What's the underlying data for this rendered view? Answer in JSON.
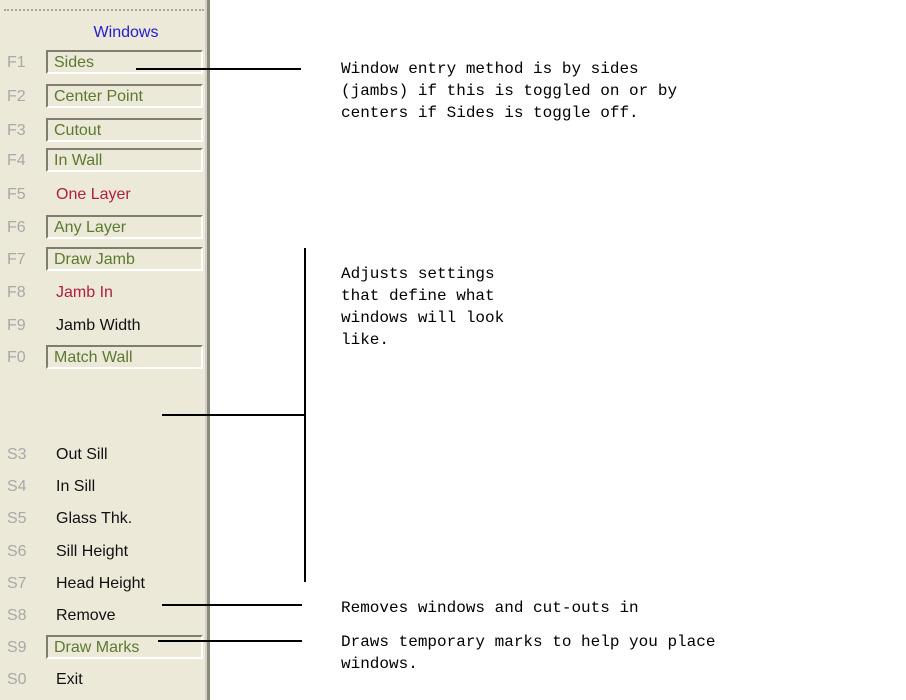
{
  "panel": {
    "title": "Windows",
    "items": [
      {
        "key": "F1",
        "label": "Sides",
        "style": "on",
        "color": "#5a7a30"
      },
      {
        "key": "F2",
        "label": "Center Point",
        "style": "on",
        "color": "#5a7a30"
      },
      {
        "key": "F3",
        "label": "Cutout",
        "style": "on",
        "color": "#5a7a30"
      },
      {
        "key": "F4",
        "label": "In Wall",
        "style": "on",
        "color": "#5a7a30"
      },
      {
        "key": "F5",
        "label": "One Layer",
        "style": "off",
        "color": "#b0203a"
      },
      {
        "key": "F6",
        "label": "Any Layer",
        "style": "on",
        "color": "#5a7a30"
      },
      {
        "key": "F7",
        "label": "Draw Jamb",
        "style": "on",
        "color": "#5a7a30"
      },
      {
        "key": "F8",
        "label": "Jamb In",
        "style": "off",
        "color": "#b0203a"
      },
      {
        "key": "F9",
        "label": "Jamb Width",
        "style": "off",
        "color": "#111111"
      },
      {
        "key": "F0",
        "label": "Match Wall",
        "style": "on",
        "color": "#5a7a30"
      },
      {
        "key": "S3",
        "label": "Out Sill",
        "style": "off",
        "color": "#111111"
      },
      {
        "key": "S4",
        "label": "In Sill",
        "style": "off",
        "color": "#111111"
      },
      {
        "key": "S5",
        "label": "Glass Thk.",
        "style": "off",
        "color": "#111111"
      },
      {
        "key": "S6",
        "label": "Sill Height",
        "style": "off",
        "color": "#111111"
      },
      {
        "key": "S7",
        "label": "Head Height",
        "style": "off",
        "color": "#111111"
      },
      {
        "key": "S8",
        "label": "Remove",
        "style": "off",
        "color": "#111111"
      },
      {
        "key": "S9",
        "label": "Draw Marks",
        "style": "on",
        "color": "#5a7a30"
      },
      {
        "key": "S0",
        "label": "Exit",
        "style": "off",
        "color": "#111111"
      }
    ]
  },
  "annotations": {
    "sides": "Window entry method is by sides\n(jambs) if this is toggled on or by\ncenters if Sides is toggle off.",
    "settings": "Adjusts settings\nthat define what\nwindows will look\nlike.",
    "remove": "Removes windows and cut-outs in",
    "marks": "Draws temporary marks to help you place\nwindows."
  }
}
